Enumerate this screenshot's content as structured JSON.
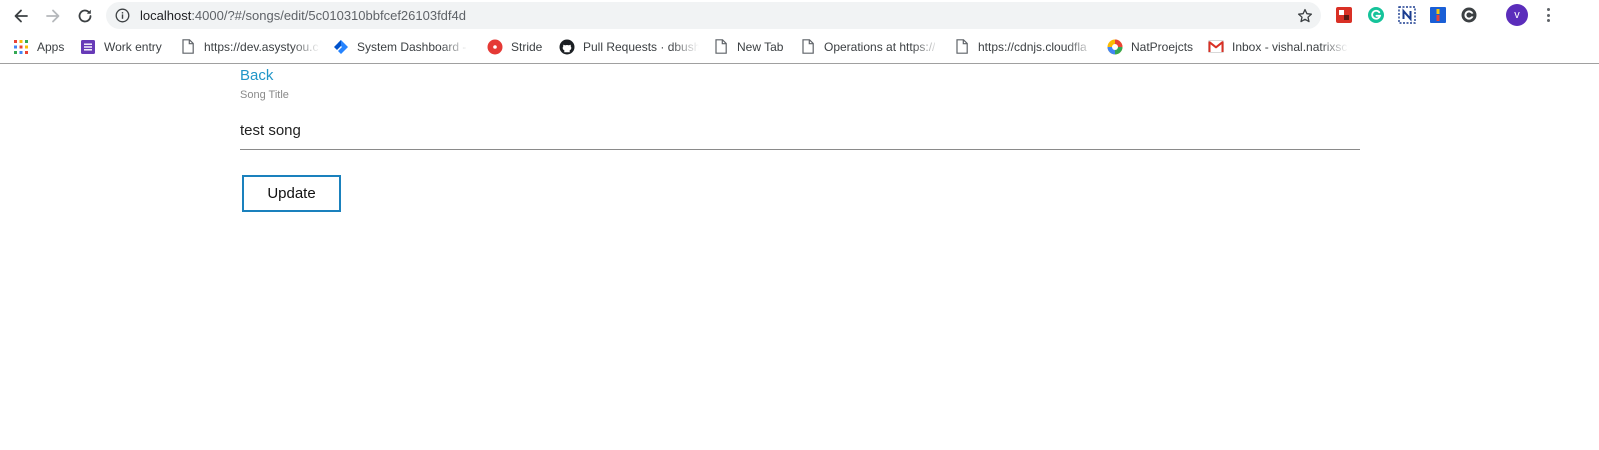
{
  "browser": {
    "url_host": "localhost",
    "url_path": ":4000/?#/songs/edit/5c010310bbfcef26103fdf4d",
    "avatar_initial": "v",
    "icons": {
      "back": "back-arrow-icon",
      "forward": "forward-arrow-icon",
      "reload": "reload-icon",
      "info": "site-info-icon",
      "star": "bookmark-star-icon",
      "menu": "kebab-menu-icon"
    },
    "extensions": [
      {
        "name": "extension-red-icon",
        "color": "#d93025"
      },
      {
        "name": "grammarly-icon",
        "color": "#15c39a"
      },
      {
        "name": "extension-n-icon",
        "color": "#1a3c8f"
      },
      {
        "name": "extension-blue-icon",
        "color": "#1a5fd6"
      },
      {
        "name": "extension-c-icon",
        "color": "#3c4043"
      }
    ]
  },
  "bookmarks": [
    {
      "label": "Apps",
      "icon": "apps-grid-icon"
    },
    {
      "label": "Work entry",
      "icon": "form-icon"
    },
    {
      "label": "https://dev.asystyou.c",
      "icon": "page-icon"
    },
    {
      "label": "System Dashboard -",
      "icon": "jira-icon"
    },
    {
      "label": "Stride",
      "icon": "stride-icon"
    },
    {
      "label": "Pull Requests · dbush",
      "icon": "github-icon"
    },
    {
      "label": "New Tab",
      "icon": "page-icon"
    },
    {
      "label": "Operations at https://",
      "icon": "page-icon"
    },
    {
      "label": "https://cdnjs.cloudfla",
      "icon": "page-icon"
    },
    {
      "label": "NatProejcts",
      "icon": "drive-icon"
    },
    {
      "label": "Inbox - vishal.natrixsc",
      "icon": "gmail-icon"
    }
  ],
  "page": {
    "back_label": "Back",
    "field_label": "Song Title",
    "song_title_value": "test song",
    "update_label": "Update"
  },
  "colors": {
    "link": "#2196c8",
    "button_border": "#1a81bd",
    "avatar": "#5b2dbb"
  }
}
